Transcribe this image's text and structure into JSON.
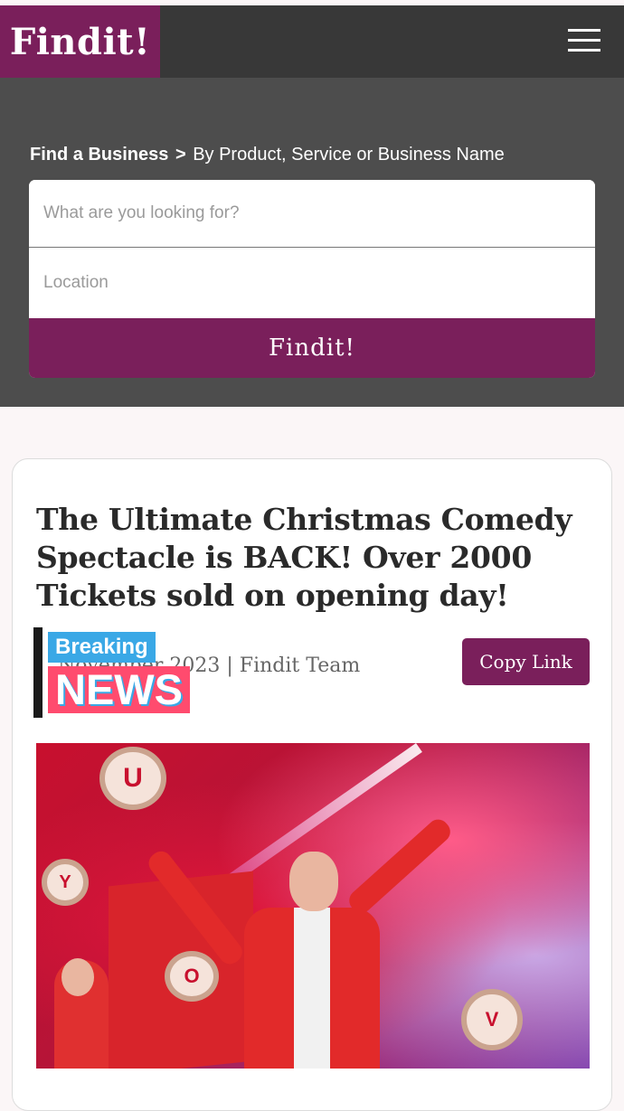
{
  "header": {
    "logo": "Findit!",
    "menu_icon": "hamburger-menu-icon"
  },
  "search": {
    "breadcrumb_main": "Find a Business",
    "breadcrumb_sep": ">",
    "breadcrumb_sub": "By Product, Service or Business Name",
    "query_placeholder": "What are you looking for?",
    "query_value": "",
    "location_placeholder": "Location",
    "location_value": "",
    "button_label": "Findit!"
  },
  "article": {
    "title": "The Ultimate Christmas Comedy Spectacle is BACK! Over 2000 Tickets sold on opening day!",
    "meta": "November 2023 | Findit Team",
    "badge_line1": "Breaking",
    "badge_line2": "NEWS",
    "copy_link_label": "Copy Link",
    "image_letters": [
      "U",
      "Y",
      "O",
      "V"
    ]
  },
  "colors": {
    "brand": "#7a1f5b",
    "header_bg": "#383838",
    "search_bg": "#4d4d4d"
  }
}
